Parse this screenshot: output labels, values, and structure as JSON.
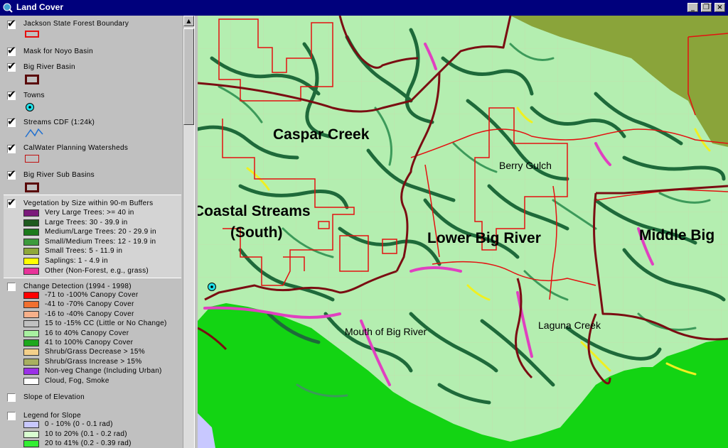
{
  "window": {
    "title": "Land Cover"
  },
  "legend": {
    "layers": [
      {
        "name": "Jackson State Forest Boundary",
        "checked": true
      },
      {
        "name": "Mask for Noyo Basin",
        "checked": true
      },
      {
        "name": "Big River Basin",
        "checked": true
      },
      {
        "name": "Towns",
        "checked": true
      },
      {
        "name": "Streams CDF (1:24k)",
        "checked": true
      },
      {
        "name": "CalWater Planning Watersheds",
        "checked": true
      },
      {
        "name": "Big River Sub Basins",
        "checked": true
      },
      {
        "name": "Vegetation by Size within 90-m Buffers",
        "checked": true
      },
      {
        "name": "Change Detection (1994 - 1998)",
        "checked": false
      },
      {
        "name": "Slope of Elevation",
        "checked": false
      },
      {
        "name": "Legend for Slope",
        "checked": false
      }
    ],
    "vegetation_classes": [
      {
        "label": "Very Large Trees: >= 40  in",
        "color": "#7b1a7b"
      },
      {
        "label": "Large Trees: 30 - 39.9 in",
        "color": "#1e5a1e"
      },
      {
        "label": "Medium/Large Trees: 20 - 29.9 in",
        "color": "#1b7a1b"
      },
      {
        "label": "Small/Medium Trees: 12 - 19.9 in",
        "color": "#3d9b3d"
      },
      {
        "label": "Small Trees: 5 - 11.9 in",
        "color": "#8fa83a"
      },
      {
        "label": "Saplings: 1 - 4.9 in",
        "color": "#ffff00"
      },
      {
        "label": "Other (Non-Forest, e.g., grass)",
        "color": "#e8339a"
      }
    ],
    "change_classes": [
      {
        "label": "-71 to -100% Canopy Cover",
        "color": "#ff0000"
      },
      {
        "label": "-41 to -70% Canopy Cover",
        "color": "#f07030"
      },
      {
        "label": "-16 to -40% Canopy Cover",
        "color": "#f6b08a"
      },
      {
        "label": "15 to -15% CC (Little or No Change)",
        "color": "#c0c0c0"
      },
      {
        "label": "16 to 40% Canopy Cover",
        "color": "#a8f0a0"
      },
      {
        "label": "41 to 100% Canopy Cover",
        "color": "#1ca81c"
      },
      {
        "label": "Shrub/Grass Decrease > 15%",
        "color": "#f4d08a"
      },
      {
        "label": "Shrub/Grass Increase > 15%",
        "color": "#a8b060"
      },
      {
        "label": "Non-veg Change (Including Urban)",
        "color": "#9b30e8"
      },
      {
        "label": "Cloud, Fog, Smoke",
        "color": "#ffffff"
      }
    ],
    "slope_classes": [
      {
        "label": "0 - 10% (0 - 0.1 rad)",
        "color": "#c8c8ff"
      },
      {
        "label": "10 to 20% (0.1 - 0.2 rad)",
        "color": "#d8ffd0"
      },
      {
        "label": "20 to 41% (0.2 - 0.39 rad)",
        "color": "#33ee33"
      }
    ]
  },
  "map": {
    "labels": {
      "caspar_creek": "Caspar Creek",
      "coastal_streams_1": "Coastal Streams",
      "coastal_streams_2": "(South)",
      "lower_big_river": "Lower Big River",
      "middle_big": "Middle Big",
      "berry_gulch": "Berry Gulch",
      "mouth_of_big_river": "Mouth of Big River",
      "laguna_creek": "Laguna Creek"
    },
    "colors": {
      "basemap": "#b4eeb0",
      "ocean": "#13d413",
      "mask": "#8aa43a",
      "boundary_red": "#e41010",
      "subbasin_maroon": "#7a0d12",
      "stream_dark": "#1e6a3a",
      "stream_mid": "#3c9a5a",
      "stream_pink": "#e040c0",
      "stream_yellow": "#f0f020"
    }
  }
}
